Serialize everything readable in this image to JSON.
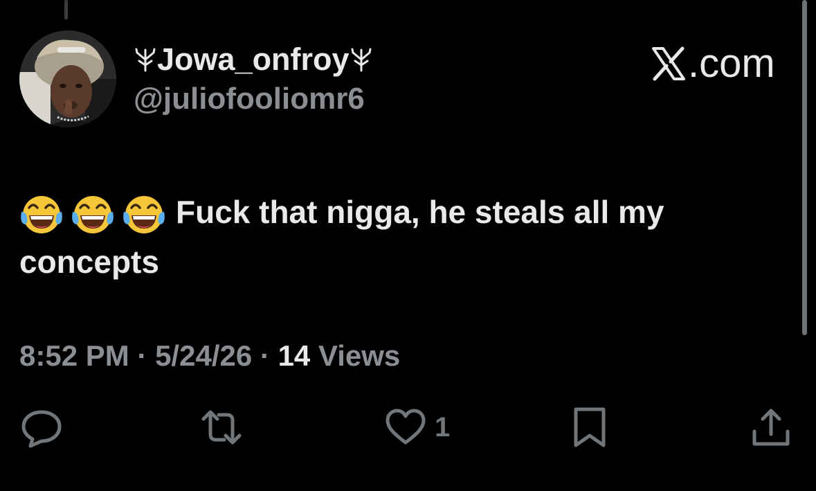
{
  "tweet": {
    "display_name": "Jowa_onfroy",
    "handle": "@juliofooliomr6",
    "site": ".com",
    "emojis": [
      "face-with-tears-of-joy",
      "face-with-tears-of-joy",
      "face-with-tears-of-joy"
    ],
    "text_line1": "Fuck that nigga, he steals all my",
    "text_line2": "concepts",
    "time": "8:52 PM",
    "separator": "·",
    "date": "5/24/26",
    "views_count": "14",
    "views_label": "Views"
  },
  "actions": {
    "reply_icon": "reply-icon",
    "retweet_icon": "retweet-icon",
    "like_icon": "heart-icon",
    "like_count": "1",
    "bookmark_icon": "bookmark-icon",
    "share_icon": "share-icon"
  },
  "colors": {
    "background": "#000000",
    "primary_text": "#e7e9ea",
    "secondary_text": "#8b8f94",
    "icon": "#71767b"
  }
}
